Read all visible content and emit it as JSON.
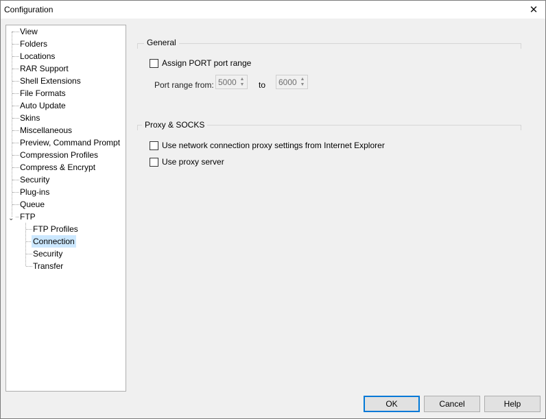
{
  "window": {
    "title": "Configuration",
    "close_glyph": "✕"
  },
  "tree": {
    "items": [
      {
        "label": "View"
      },
      {
        "label": "Folders"
      },
      {
        "label": "Locations"
      },
      {
        "label": "RAR Support"
      },
      {
        "label": "Shell Extensions"
      },
      {
        "label": "File Formats"
      },
      {
        "label": "Auto Update"
      },
      {
        "label": "Skins"
      },
      {
        "label": "Miscellaneous"
      },
      {
        "label": "Preview, Command Prompt"
      },
      {
        "label": "Compression Profiles"
      },
      {
        "label": "Compress & Encrypt"
      },
      {
        "label": "Security"
      },
      {
        "label": "Plug-ins"
      },
      {
        "label": "Queue"
      },
      {
        "label": "FTP"
      }
    ],
    "ftp_children": [
      {
        "label": "FTP Profiles"
      },
      {
        "label": "Connection"
      },
      {
        "label": "Security"
      },
      {
        "label": "Transfer"
      }
    ],
    "selected": "Connection",
    "expander_glyph": "⌄"
  },
  "general": {
    "title": "General",
    "assign_port_label": "Assign PORT port range",
    "assign_port_checked": false,
    "port_range_from_label": "Port range from:",
    "port_from": "5000",
    "to_label": "to",
    "port_to": "6000"
  },
  "proxy": {
    "title": "Proxy & SOCKS",
    "use_ie_label": "Use network connection proxy settings from Internet Explorer",
    "use_ie_checked": false,
    "use_proxy_label": "Use proxy server",
    "use_proxy_checked": false
  },
  "buttons": {
    "ok": "OK",
    "cancel": "Cancel",
    "help": "Help"
  }
}
